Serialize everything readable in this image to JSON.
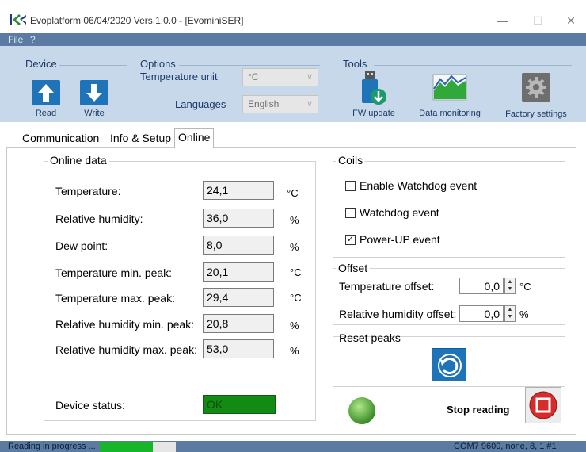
{
  "window": {
    "title": "Evoplatform 06/04/2020 Vers.1.0.0 - [EvominiSER]",
    "minimize_glyph": "—",
    "maximize_glyph": "☐",
    "close_glyph": "✕",
    "logo_icon": "evo-logo-icon"
  },
  "menu": {
    "items": [
      "File",
      "?"
    ]
  },
  "ribbon": {
    "device": {
      "label": "Device",
      "read": "Read",
      "write": "Write"
    },
    "options": {
      "label": "Options",
      "temperature_unit_label": "Temperature unit",
      "temperature_unit_value": "°C",
      "languages_label": "Languages",
      "languages_value": "English"
    },
    "tools": {
      "label": "Tools",
      "fw_update": "FW update",
      "data_monitoring": "Data monitoring",
      "factory_settings": "Factory settings"
    }
  },
  "tabs": [
    "Communication",
    "Info & Setup",
    "Online"
  ],
  "active_tab": "Online",
  "online_data": {
    "title": "Online data",
    "rows": [
      {
        "label": "Temperature:",
        "value": "24,1",
        "unit": "°C"
      },
      {
        "label": "Relative humidity:",
        "value": "36,0",
        "unit": "%"
      },
      {
        "label": "Dew point:",
        "value": "8,0",
        "unit": "%"
      },
      {
        "label": "Temperature min. peak:",
        "value": "20,1",
        "unit": "°C"
      },
      {
        "label": "Temperature max. peak:",
        "value": "29,4",
        "unit": "°C"
      },
      {
        "label": "Relative humidity min. peak:",
        "value": "20,8",
        "unit": "%"
      },
      {
        "label": "Relative humidity max. peak:",
        "value": "53,0",
        "unit": "%"
      }
    ],
    "device_status_label": "Device status:",
    "device_status_value": "OK"
  },
  "coils": {
    "title": "Coils",
    "items": [
      {
        "label": "Enable Watchdog event",
        "checked": false
      },
      {
        "label": "Watchdog event",
        "checked": false
      },
      {
        "label": "Power-UP event",
        "checked": true
      }
    ],
    "check_glyph": "✓"
  },
  "offset": {
    "title": "Offset",
    "temperature_label": "Temperature offset:",
    "temperature_value": "0,0",
    "temperature_unit": "°C",
    "humidity_label": "Relative humidity offset:",
    "humidity_value": "0,0",
    "humidity_unit": "%"
  },
  "reset_peaks": {
    "title": "Reset peaks"
  },
  "stop_reading": {
    "label": "Stop reading"
  },
  "status_bar": {
    "left": "Reading in progress ...",
    "progress": 0.7,
    "right": "COM7 9600, none, 8, 1 #1"
  },
  "colors": {
    "ribbon": "#c7d8ea",
    "menubar": "#5b7ba3",
    "accent_blue": "#1e73b9",
    "status_ok": "#138a13",
    "stop_red": "#d62c2c"
  }
}
